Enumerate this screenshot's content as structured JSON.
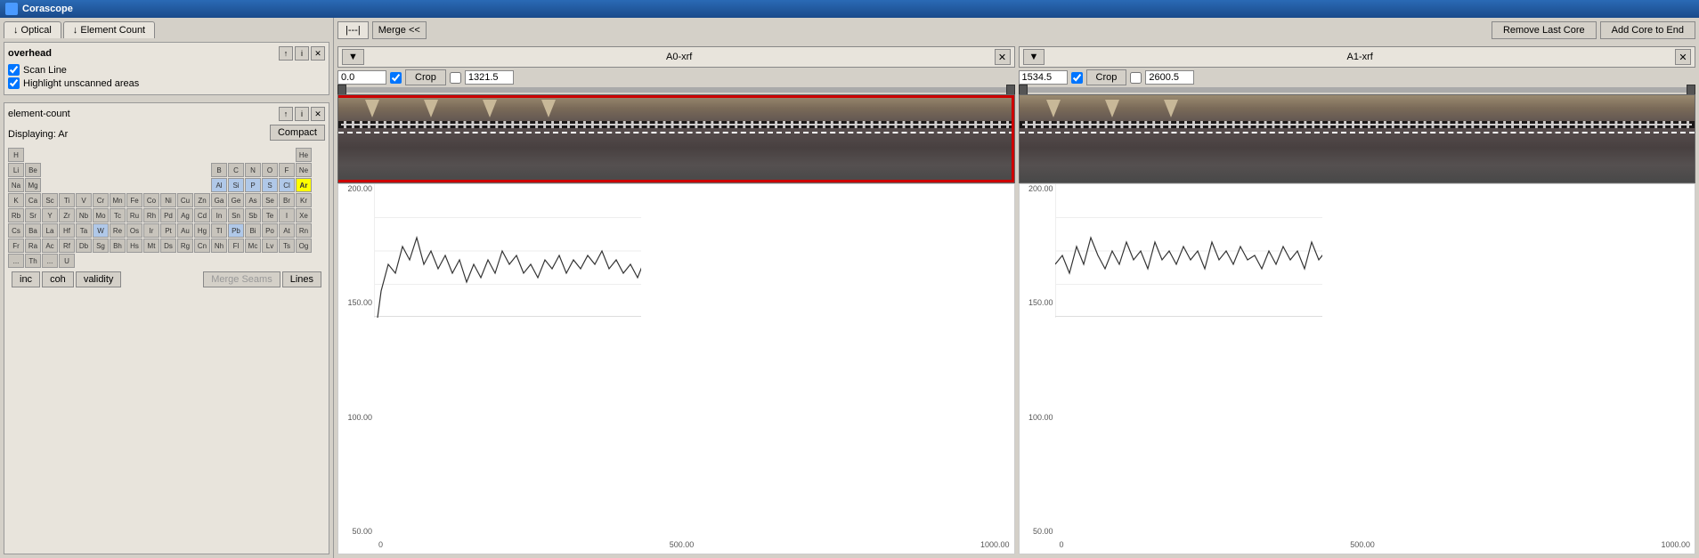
{
  "app": {
    "title": "Corascope"
  },
  "toolbar": {
    "merge_label": "Merge <<",
    "ruler_label": "|---|",
    "remove_last_core": "Remove Last Core",
    "add_core_to_end": "Add Core to End"
  },
  "tabs": [
    {
      "label": "↓ Optical",
      "active": false
    },
    {
      "label": "↓ Element Count",
      "active": false
    }
  ],
  "overhead": {
    "title": "overhead",
    "scan_line": "Scan Line",
    "highlight_unscanned": "Highlight unscanned areas"
  },
  "element_count": {
    "title": "element-count",
    "displaying": "Displaying: Ar",
    "compact_btn": "Compact",
    "merge_seams_btn": "Merge Seams",
    "lines_btn": "Lines",
    "bottom_tabs": [
      "inc",
      "coh",
      "validity"
    ]
  },
  "periodic_table": {
    "rows": [
      [
        {
          "symbol": "H",
          "active": false
        },
        {
          "symbol": "",
          "empty": true
        },
        {
          "symbol": "",
          "empty": true
        },
        {
          "symbol": "",
          "empty": true
        },
        {
          "symbol": "",
          "empty": true
        },
        {
          "symbol": "",
          "empty": true
        },
        {
          "symbol": "",
          "empty": true
        },
        {
          "symbol": "",
          "empty": true
        },
        {
          "symbol": "",
          "empty": true
        },
        {
          "symbol": "",
          "empty": true
        },
        {
          "symbol": "",
          "empty": true
        },
        {
          "symbol": "",
          "empty": true
        },
        {
          "symbol": "",
          "empty": true
        },
        {
          "symbol": "",
          "empty": true
        },
        {
          "symbol": "",
          "empty": true
        },
        {
          "symbol": "",
          "empty": true
        },
        {
          "symbol": "",
          "empty": true
        },
        {
          "symbol": "He",
          "active": false
        }
      ],
      [
        {
          "symbol": "Li",
          "active": false
        },
        {
          "symbol": "Be",
          "active": false
        },
        {
          "symbol": "",
          "empty": true
        },
        {
          "symbol": "",
          "empty": true
        },
        {
          "symbol": "",
          "empty": true
        },
        {
          "symbol": "",
          "empty": true
        },
        {
          "symbol": "",
          "empty": true
        },
        {
          "symbol": "",
          "empty": true
        },
        {
          "symbol": "",
          "empty": true
        },
        {
          "symbol": "",
          "empty": true
        },
        {
          "symbol": "",
          "empty": true
        },
        {
          "symbol": "",
          "empty": true
        },
        {
          "symbol": "B",
          "active": false
        },
        {
          "symbol": "C",
          "active": false
        },
        {
          "symbol": "N",
          "active": false
        },
        {
          "symbol": "O",
          "active": false
        },
        {
          "symbol": "F",
          "active": false
        },
        {
          "symbol": "Ne",
          "active": false
        }
      ],
      [
        {
          "symbol": "Na",
          "active": false
        },
        {
          "symbol": "Mg",
          "active": false
        },
        {
          "symbol": "",
          "empty": true
        },
        {
          "symbol": "",
          "empty": true
        },
        {
          "symbol": "",
          "empty": true
        },
        {
          "symbol": "",
          "empty": true
        },
        {
          "symbol": "",
          "empty": true
        },
        {
          "symbol": "",
          "empty": true
        },
        {
          "symbol": "",
          "empty": true
        },
        {
          "symbol": "",
          "empty": true
        },
        {
          "symbol": "",
          "empty": true
        },
        {
          "symbol": "",
          "empty": true
        },
        {
          "symbol": "Al",
          "highlight": true
        },
        {
          "symbol": "Si",
          "highlight": true
        },
        {
          "symbol": "P",
          "highlight": true
        },
        {
          "symbol": "S",
          "highlight": true
        },
        {
          "symbol": "Cl",
          "highlight": true
        },
        {
          "symbol": "Ar",
          "selected": true
        }
      ],
      [
        {
          "symbol": "K",
          "active": false
        },
        {
          "symbol": "Ca",
          "active": false
        },
        {
          "symbol": "Sc",
          "active": false
        },
        {
          "symbol": "Ti",
          "active": false
        },
        {
          "symbol": "V",
          "active": false
        },
        {
          "symbol": "Cr",
          "active": false
        },
        {
          "symbol": "Mn",
          "active": false
        },
        {
          "symbol": "Fe",
          "active": false
        },
        {
          "symbol": "Co",
          "active": false
        },
        {
          "symbol": "Ni",
          "active": false
        },
        {
          "symbol": "Cu",
          "active": false
        },
        {
          "symbol": "Zn",
          "active": false
        },
        {
          "symbol": "Ga",
          "active": false
        },
        {
          "symbol": "Ge",
          "active": false
        },
        {
          "symbol": "As",
          "active": false
        },
        {
          "symbol": "Se",
          "active": false
        },
        {
          "symbol": "Br",
          "active": false
        },
        {
          "symbol": "Kr",
          "active": false
        }
      ],
      [
        {
          "symbol": "Rb",
          "active": false
        },
        {
          "symbol": "Sr",
          "active": false
        },
        {
          "symbol": "Y",
          "active": false
        },
        {
          "symbol": "Zr",
          "active": false
        },
        {
          "symbol": "Nb",
          "active": false
        },
        {
          "symbol": "Mo",
          "active": false
        },
        {
          "symbol": "Tc",
          "active": false
        },
        {
          "symbol": "Ru",
          "active": false
        },
        {
          "symbol": "Rh",
          "active": false
        },
        {
          "symbol": "Pd",
          "active": false
        },
        {
          "symbol": "Ag",
          "active": false
        },
        {
          "symbol": "Cd",
          "active": false
        },
        {
          "symbol": "In",
          "active": false
        },
        {
          "symbol": "Sn",
          "active": false
        },
        {
          "symbol": "Sb",
          "active": false
        },
        {
          "symbol": "Te",
          "active": false
        },
        {
          "symbol": "I",
          "active": false
        },
        {
          "symbol": "Xe",
          "active": false
        }
      ],
      [
        {
          "symbol": "Cs",
          "active": false
        },
        {
          "symbol": "Ba",
          "active": false
        },
        {
          "symbol": "La",
          "active": false
        },
        {
          "symbol": "Hf",
          "active": false
        },
        {
          "symbol": "Ta",
          "active": false
        },
        {
          "symbol": "W",
          "highlight": true
        },
        {
          "symbol": "Re",
          "active": false
        },
        {
          "symbol": "Os",
          "active": false
        },
        {
          "symbol": "Ir",
          "active": false
        },
        {
          "symbol": "Pt",
          "active": false
        },
        {
          "symbol": "Au",
          "active": false
        },
        {
          "symbol": "Hg",
          "active": false
        },
        {
          "symbol": "Tl",
          "active": false
        },
        {
          "symbol": "Pb",
          "highlight": true
        },
        {
          "symbol": "Bi",
          "active": false
        },
        {
          "symbol": "Po",
          "active": false
        },
        {
          "symbol": "At",
          "active": false
        },
        {
          "symbol": "Rn",
          "active": false
        }
      ],
      [
        {
          "symbol": "Fr",
          "active": false
        },
        {
          "symbol": "Ra",
          "active": false
        },
        {
          "symbol": "Ac",
          "active": false
        },
        {
          "symbol": "Rf",
          "active": false
        },
        {
          "symbol": "Db",
          "active": false
        },
        {
          "symbol": "Sg",
          "active": false
        },
        {
          "symbol": "Bh",
          "active": false
        },
        {
          "symbol": "Hs",
          "active": false
        },
        {
          "symbol": "Mt",
          "active": false
        },
        {
          "symbol": "Ds",
          "active": false
        },
        {
          "symbol": "Rg",
          "active": false
        },
        {
          "symbol": "Cn",
          "active": false
        },
        {
          "symbol": "Nh",
          "active": false
        },
        {
          "symbol": "Fl",
          "active": false
        },
        {
          "symbol": "Mc",
          "active": false
        },
        {
          "symbol": "Lv",
          "active": false
        },
        {
          "symbol": "Ts",
          "active": false
        },
        {
          "symbol": "Og",
          "active": false
        }
      ],
      [
        {
          "symbol": "...",
          "active": false
        },
        {
          "symbol": "Th",
          "active": false
        },
        {
          "symbol": "...",
          "active": false
        },
        {
          "symbol": "U",
          "active": false
        }
      ]
    ]
  },
  "cores": [
    {
      "id": "a0",
      "title": "A0-xrf",
      "start_value": "0.0",
      "start_checked": true,
      "end_value": "1321.5",
      "end_checked": false,
      "crop_label": "Crop",
      "chart": {
        "y_labels": [
          "200.00",
          "150.00",
          "100.00",
          "50.00"
        ],
        "x_labels": [
          "0",
          "500.00",
          "1000.00"
        ]
      }
    },
    {
      "id": "a1",
      "title": "A1-xrf",
      "start_value": "1534.5",
      "start_checked": true,
      "end_value": "2600.5",
      "end_checked": false,
      "crop_label": "Crop",
      "chart": {
        "y_labels": [
          "200.00",
          "150.00",
          "100.00",
          "50.00"
        ],
        "x_labels": [
          "0",
          "500.00",
          "1000.00"
        ]
      }
    }
  ]
}
